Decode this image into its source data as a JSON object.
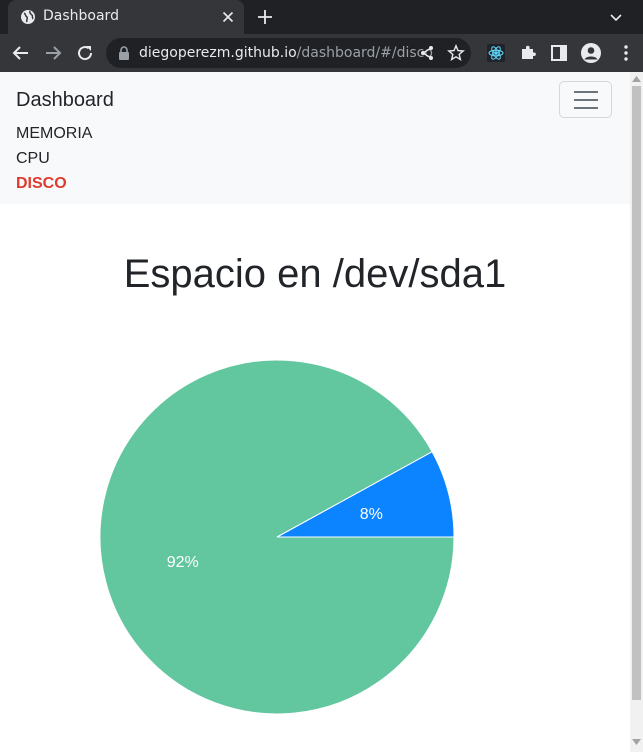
{
  "browser": {
    "tab_title": "Dashboard",
    "url_host": "diegoperezm.github.io",
    "url_path": "/dashboard/#/disco"
  },
  "navbar": {
    "brand": "Dashboard",
    "links": [
      {
        "label": "MEMORIA",
        "active": false
      },
      {
        "label": "CPU",
        "active": false
      },
      {
        "label": "DISCO",
        "active": true
      }
    ]
  },
  "page": {
    "title": "Espacio en /dev/sda1"
  },
  "colors": {
    "active_link": "#e03a2f",
    "used_slice": "#0d84ff",
    "free_slice": "#62c69f"
  },
  "icons": [
    "globe-icon",
    "close-icon",
    "plus-icon",
    "chevron-down-icon",
    "back-arrow-icon",
    "forward-arrow-icon",
    "reload-icon",
    "lock-icon",
    "share-icon",
    "star-icon",
    "react-devtools-icon",
    "puzzle-icon",
    "side-panel-icon",
    "profile-icon",
    "more-vert-icon",
    "hamburger-icon"
  ],
  "chart_data": {
    "type": "pie",
    "title": "",
    "slices": [
      {
        "label": "8%",
        "value": 8,
        "color": "#0d84ff"
      },
      {
        "label": "92%",
        "value": 92,
        "color": "#62c69f"
      }
    ]
  }
}
